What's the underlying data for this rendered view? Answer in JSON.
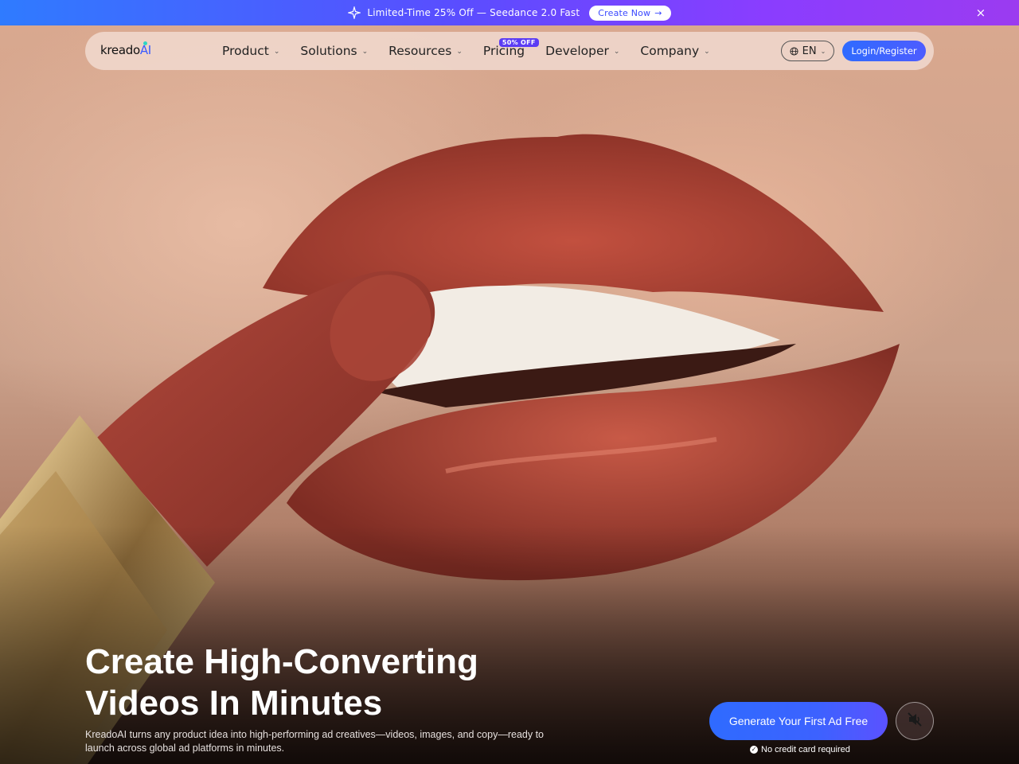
{
  "promo": {
    "text": "Limited-Time 25% Off — Seedance 2.0 Fast",
    "cta_label": "Create Now",
    "cta_arrow": "→",
    "close_icon": "×"
  },
  "nav": {
    "logo": "kreadoAI",
    "logo_main": "kreado",
    "logo_ai": "AI",
    "items": [
      {
        "label": "Product",
        "has_dropdown": true
      },
      {
        "label": "Solutions",
        "has_dropdown": true
      },
      {
        "label": "Resources",
        "has_dropdown": true
      },
      {
        "label": "Pricing",
        "has_dropdown": false,
        "badge": "50% OFF"
      },
      {
        "label": "Developer",
        "has_dropdown": true
      },
      {
        "label": "Company",
        "has_dropdown": true
      }
    ],
    "language": "EN",
    "login_label": "Login/Register"
  },
  "hero": {
    "headline_line1": "Create High-Converting",
    "headline_line2": "Videos In Minutes",
    "subtext": "KreadoAI turns any product idea into high-performing ad creatives—videos, images, and copy—ready to launch across global ad platforms in minutes.",
    "cta_label": "Generate Your First Ad Free",
    "no_credit_card": "No credit card required",
    "mute_icon": "speaker-muted-icon"
  },
  "colors": {
    "accent": "#3b5bff",
    "promo_gradient_start": "#2f7bff",
    "promo_gradient_end": "#9b3bf0",
    "badge": "#5b3cf4"
  }
}
